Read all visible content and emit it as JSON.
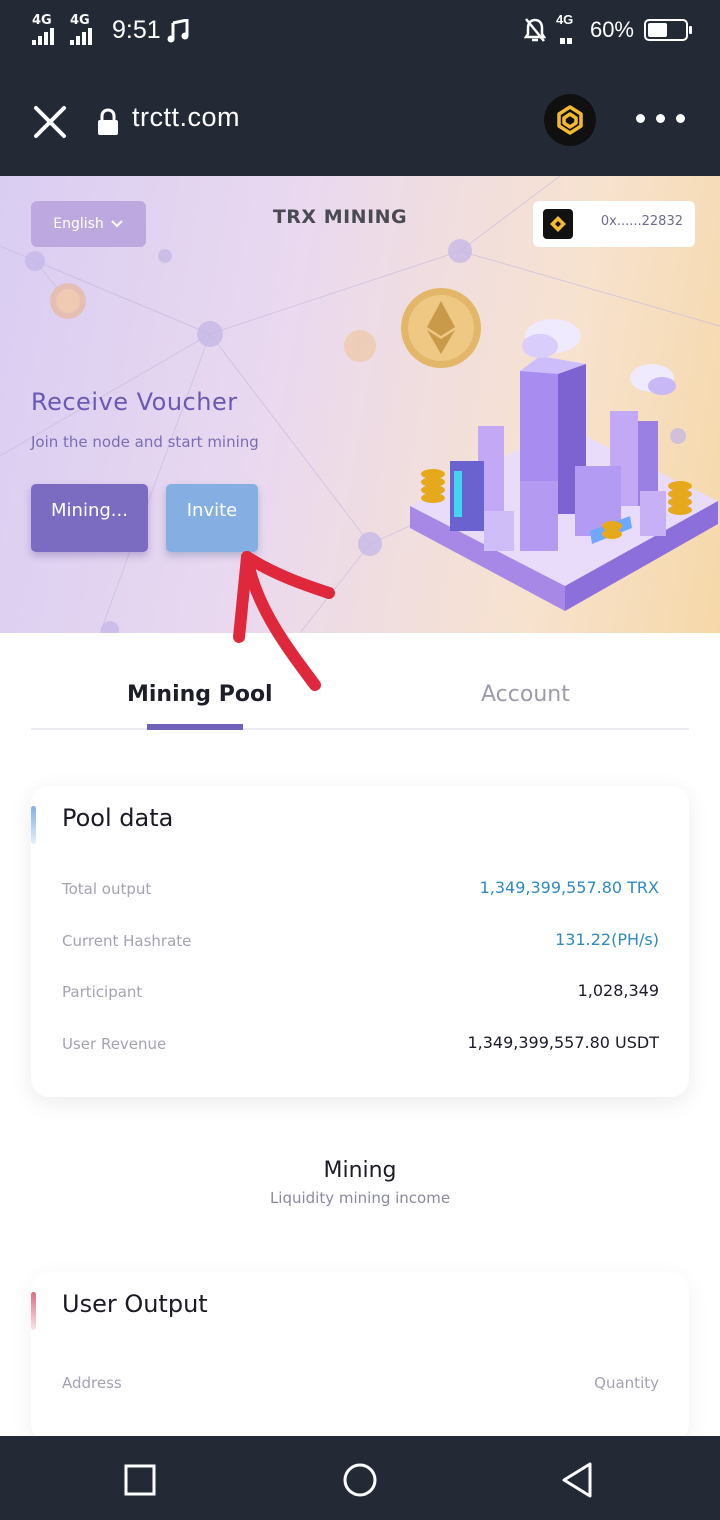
{
  "status_bar": {
    "network1": "4G",
    "network2": "4G",
    "time": "9:51",
    "network3": "4G",
    "battery_text": "60%",
    "battery_level": 0.6
  },
  "browser": {
    "url": "trctt.com"
  },
  "hero": {
    "language": "English",
    "title": "TRX MINING",
    "wallet_address": "0x......22832",
    "heading": "Receive Voucher",
    "subheading": "Join the node and start mining",
    "mining_button": "Mining...",
    "invite_button": "Invite"
  },
  "tabs": [
    {
      "label": "Mining Pool",
      "active": true
    },
    {
      "label": "Account",
      "active": false
    }
  ],
  "pool_data": {
    "title": "Pool data",
    "rows": [
      {
        "label": "Total output",
        "value": "1,349,399,557.80 TRX"
      },
      {
        "label": "Current Hashrate",
        "value": "131.22(PH/s)"
      },
      {
        "label": "Participant",
        "value": "1,028,349"
      },
      {
        "label": "User Revenue",
        "value": "1,349,399,557.80 USDT"
      }
    ]
  },
  "mining_section": {
    "title": "Mining",
    "subtitle": "Liquidity mining income"
  },
  "user_output": {
    "title": "User Output",
    "columns": [
      "Address",
      "Quantity"
    ]
  },
  "colors": {
    "accent_purple": "#7161b8",
    "value_blue": "#2e8bbd",
    "dark_bar": "#232a36",
    "annotation_red": "#e0283c"
  }
}
